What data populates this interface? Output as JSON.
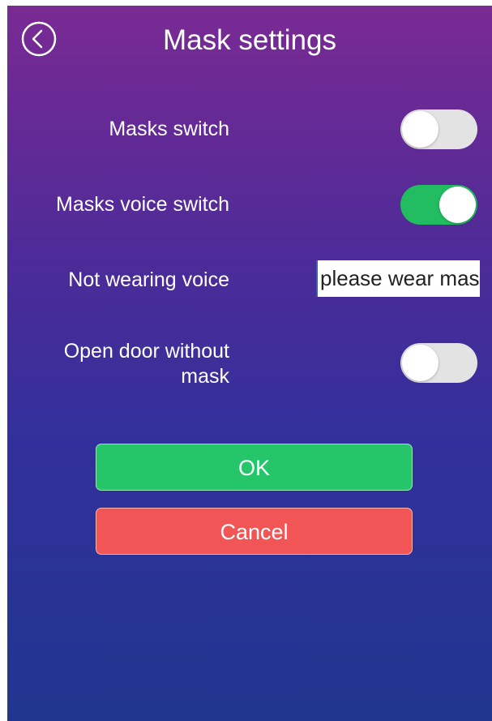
{
  "header": {
    "title": "Mask settings"
  },
  "settings": {
    "masks_switch": {
      "label": "Masks switch",
      "on": false
    },
    "masks_voice_switch": {
      "label": "Masks voice switch",
      "on": true
    },
    "not_wearing_voice": {
      "label": "Not wearing voice",
      "value": "please wear mask"
    },
    "open_door_without_mask": {
      "label_line1": "Open door without",
      "label_line2": "mask",
      "on": false
    }
  },
  "buttons": {
    "ok_label": "OK",
    "cancel_label": "Cancel"
  },
  "colors": {
    "toggle_on": "#22bd60",
    "toggle_off": "#e3e3e3",
    "ok_button": "#25c56a",
    "cancel_button": "#f25555",
    "gradient_top": "#7a2a93",
    "gradient_bottom": "#20368e"
  },
  "icons": {
    "back": "back-circle-chevron-icon"
  }
}
